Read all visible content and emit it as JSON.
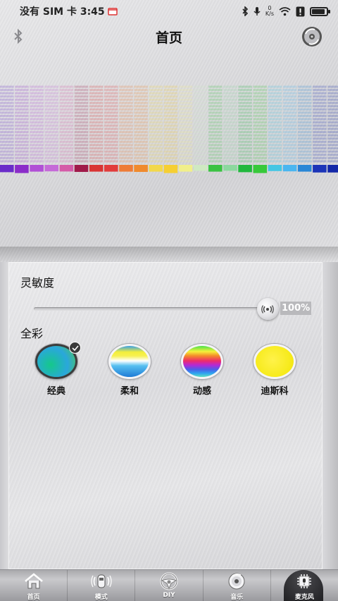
{
  "status_bar": {
    "carrier_time": "没有 SIM 卡 3:45",
    "speed_value": "0",
    "speed_unit": "K/s",
    "battery_level_pct": 90
  },
  "header": {
    "title": "首页",
    "bluetooth_icon": "bluetooth-icon",
    "disc_icon": "disc-icon"
  },
  "equalizer": {
    "columns": [
      {
        "color": "#6a2cc9",
        "level": 0.55
      },
      {
        "color": "#8b2cc9",
        "level": 0.7
      },
      {
        "color": "#b14fd6",
        "level": 0.45
      },
      {
        "color": "#c56ad8",
        "level": 0.4
      },
      {
        "color": "#d55ba8",
        "level": 0.42
      },
      {
        "color": "#a01a4a",
        "level": 0.5
      },
      {
        "color": "#d93434",
        "level": 0.45
      },
      {
        "color": "#e23c3c",
        "level": 0.45
      },
      {
        "color": "#ee7c37",
        "level": 0.45
      },
      {
        "color": "#f08a2d",
        "level": 0.5
      },
      {
        "color": "#f2d84a",
        "level": 0.45
      },
      {
        "color": "#f6cf32",
        "level": 0.7
      },
      {
        "color": "#f1ef8a",
        "level": 0.45
      },
      {
        "color": "#cfe9c2",
        "level": 0.3
      },
      {
        "color": "#3bc243",
        "level": 0.45
      },
      {
        "color": "#8cd89e",
        "level": 0.3
      },
      {
        "color": "#22b83e",
        "level": 0.55
      },
      {
        "color": "#37c93a",
        "level": 0.7
      },
      {
        "color": "#45c6e4",
        "level": 0.35
      },
      {
        "color": "#4ab6f0",
        "level": 0.4
      },
      {
        "color": "#2a87d6",
        "level": 0.45
      },
      {
        "color": "#1c34b8",
        "level": 0.6
      },
      {
        "color": "#1428a8",
        "level": 0.6
      }
    ]
  },
  "panel": {
    "sensitivity_label": "灵敏度",
    "slider_value": 100,
    "slider_display": "100%",
    "fullcolor_label": "全彩",
    "modes": [
      {
        "label": "经典",
        "selected": true
      },
      {
        "label": "柔和",
        "selected": false
      },
      {
        "label": "动感",
        "selected": false
      },
      {
        "label": "迪斯科",
        "selected": false
      }
    ]
  },
  "bottom_nav": {
    "items": [
      {
        "label": "首页",
        "icon": "home-icon",
        "active": false
      },
      {
        "label": "模式",
        "icon": "car-mode-icon",
        "active": false
      },
      {
        "label": "DIY",
        "icon": "steering-wheel-icon",
        "active": false
      },
      {
        "label": "音乐",
        "icon": "music-disc-icon",
        "active": false
      },
      {
        "label": "麦克风",
        "icon": "microphone-chip-icon",
        "active": true
      }
    ]
  }
}
